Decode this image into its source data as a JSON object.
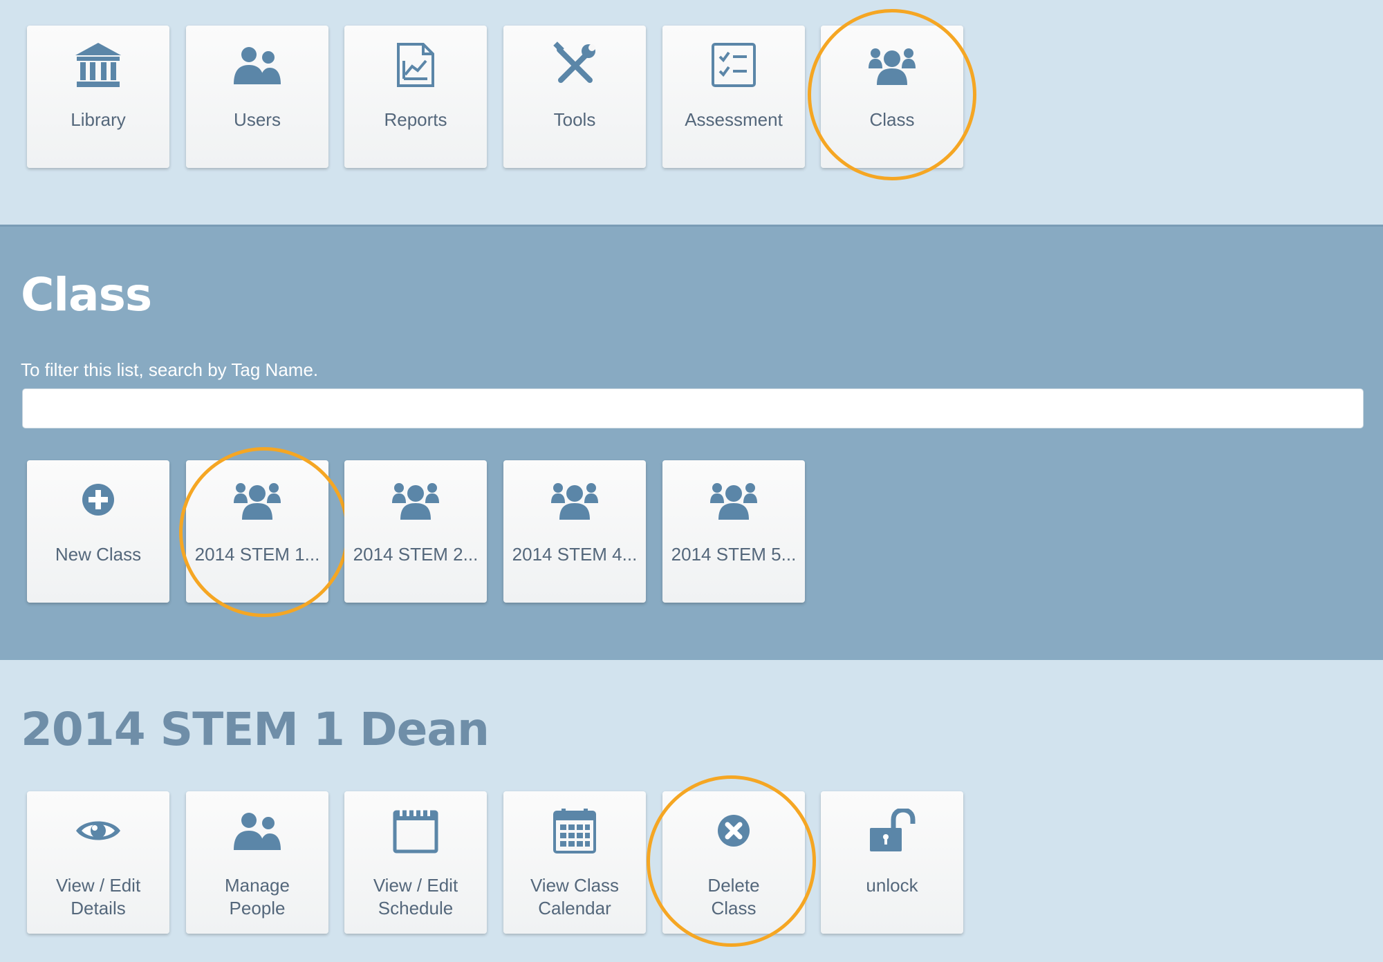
{
  "colors": {
    "page_background": "#d2e3ee",
    "class_panel_background": "#88aac2",
    "tile_background": "#f7f7f7",
    "tile_label": "#54677b",
    "icon": "#5b86a8",
    "highlight_circle": "#f5a623",
    "detail_title": "#6f8ea8"
  },
  "top_menu": {
    "items": [
      {
        "label": "Library",
        "icon": "library-icon"
      },
      {
        "label": "Users",
        "icon": "users-icon"
      },
      {
        "label": "Reports",
        "icon": "reports-icon"
      },
      {
        "label": "Tools",
        "icon": "tools-icon"
      },
      {
        "label": "Assessment",
        "icon": "assessment-icon"
      },
      {
        "label": "Class",
        "icon": "class-icon",
        "highlighted": true
      }
    ]
  },
  "class_section": {
    "title": "Class",
    "filter_hint": "To filter this list, search by Tag Name.",
    "filter_value": "",
    "tiles": [
      {
        "label": "New Class",
        "icon": "plus-circle-icon"
      },
      {
        "label": "2014 STEM 1...",
        "icon": "group-icon",
        "highlighted": true
      },
      {
        "label": "2014 STEM 2...",
        "icon": "group-icon"
      },
      {
        "label": "2014 STEM 4...",
        "icon": "group-icon"
      },
      {
        "label": "2014 STEM 5...",
        "icon": "group-icon"
      }
    ]
  },
  "detail_section": {
    "title": "2014 STEM 1 Dean",
    "actions": [
      {
        "label": "View / Edit\nDetails",
        "icon": "eye-icon"
      },
      {
        "label": "Manage\nPeople",
        "icon": "users-icon"
      },
      {
        "label": "View / Edit\nSchedule",
        "icon": "notepad-icon"
      },
      {
        "label": "View Class\nCalendar",
        "icon": "calendar-icon"
      },
      {
        "label": "Delete\nClass",
        "icon": "x-circle-icon",
        "highlighted": true
      },
      {
        "label": "unlock",
        "icon": "unlock-icon"
      }
    ]
  }
}
